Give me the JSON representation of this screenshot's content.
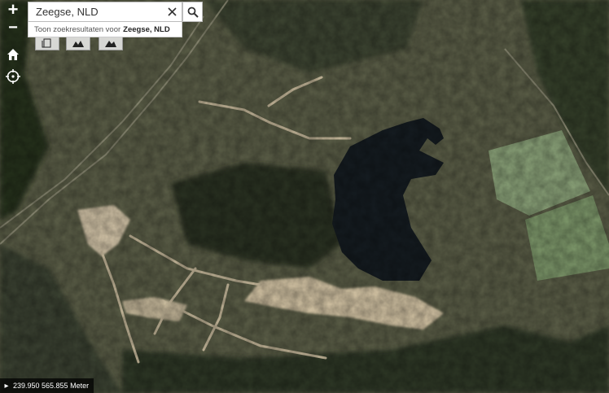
{
  "controls": {
    "zoom_in_label": "+",
    "zoom_out_label": "−",
    "home_icon": "home-icon",
    "locate_icon": "crosshair-icon"
  },
  "search": {
    "value": "Zeegse, NLD",
    "suggestion_prefix": "Toon zoekresultaten voor",
    "suggestion_term": "Zeegse, NLD"
  },
  "tools": [
    "layers-icon",
    "basemap-icon",
    "basemap-alt-icon"
  ],
  "status": {
    "scale_icon": "expand-icon",
    "coordinates": "239.950 565.855 Meter"
  },
  "colors": {
    "water": "#141b20",
    "sand": "#d8c9ad",
    "heath": "#5a5c45",
    "forest": "#2f3a2a",
    "meadow": "#8fa47c"
  }
}
